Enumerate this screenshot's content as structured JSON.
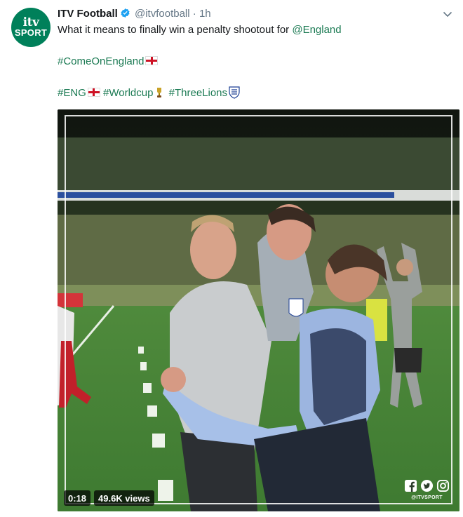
{
  "tweet": {
    "avatar": {
      "line1": "itv",
      "line2": "SPORT"
    },
    "author_name": "ITV Football",
    "handle": "@itvfootball",
    "separator": "·",
    "time": "1h",
    "text": {
      "line1_prefix": "What it means to finally win a penalty shootout for ",
      "line1_mention": "@England",
      "line2_hashtag": "#ComeOnEngland",
      "line3_tags": [
        "#ENG",
        "#Worldcup",
        "#ThreeLions"
      ]
    }
  },
  "video": {
    "duration": "0:18",
    "views": "49.6K views",
    "watermark": "@ITVSPORT",
    "social_icons": [
      "facebook-icon",
      "twitter-icon",
      "instagram-icon"
    ]
  },
  "colors": {
    "brand_green": "#00805a",
    "link_green": "#1b7a53",
    "verified_blue": "#1da1f2",
    "muted": "#657786"
  }
}
